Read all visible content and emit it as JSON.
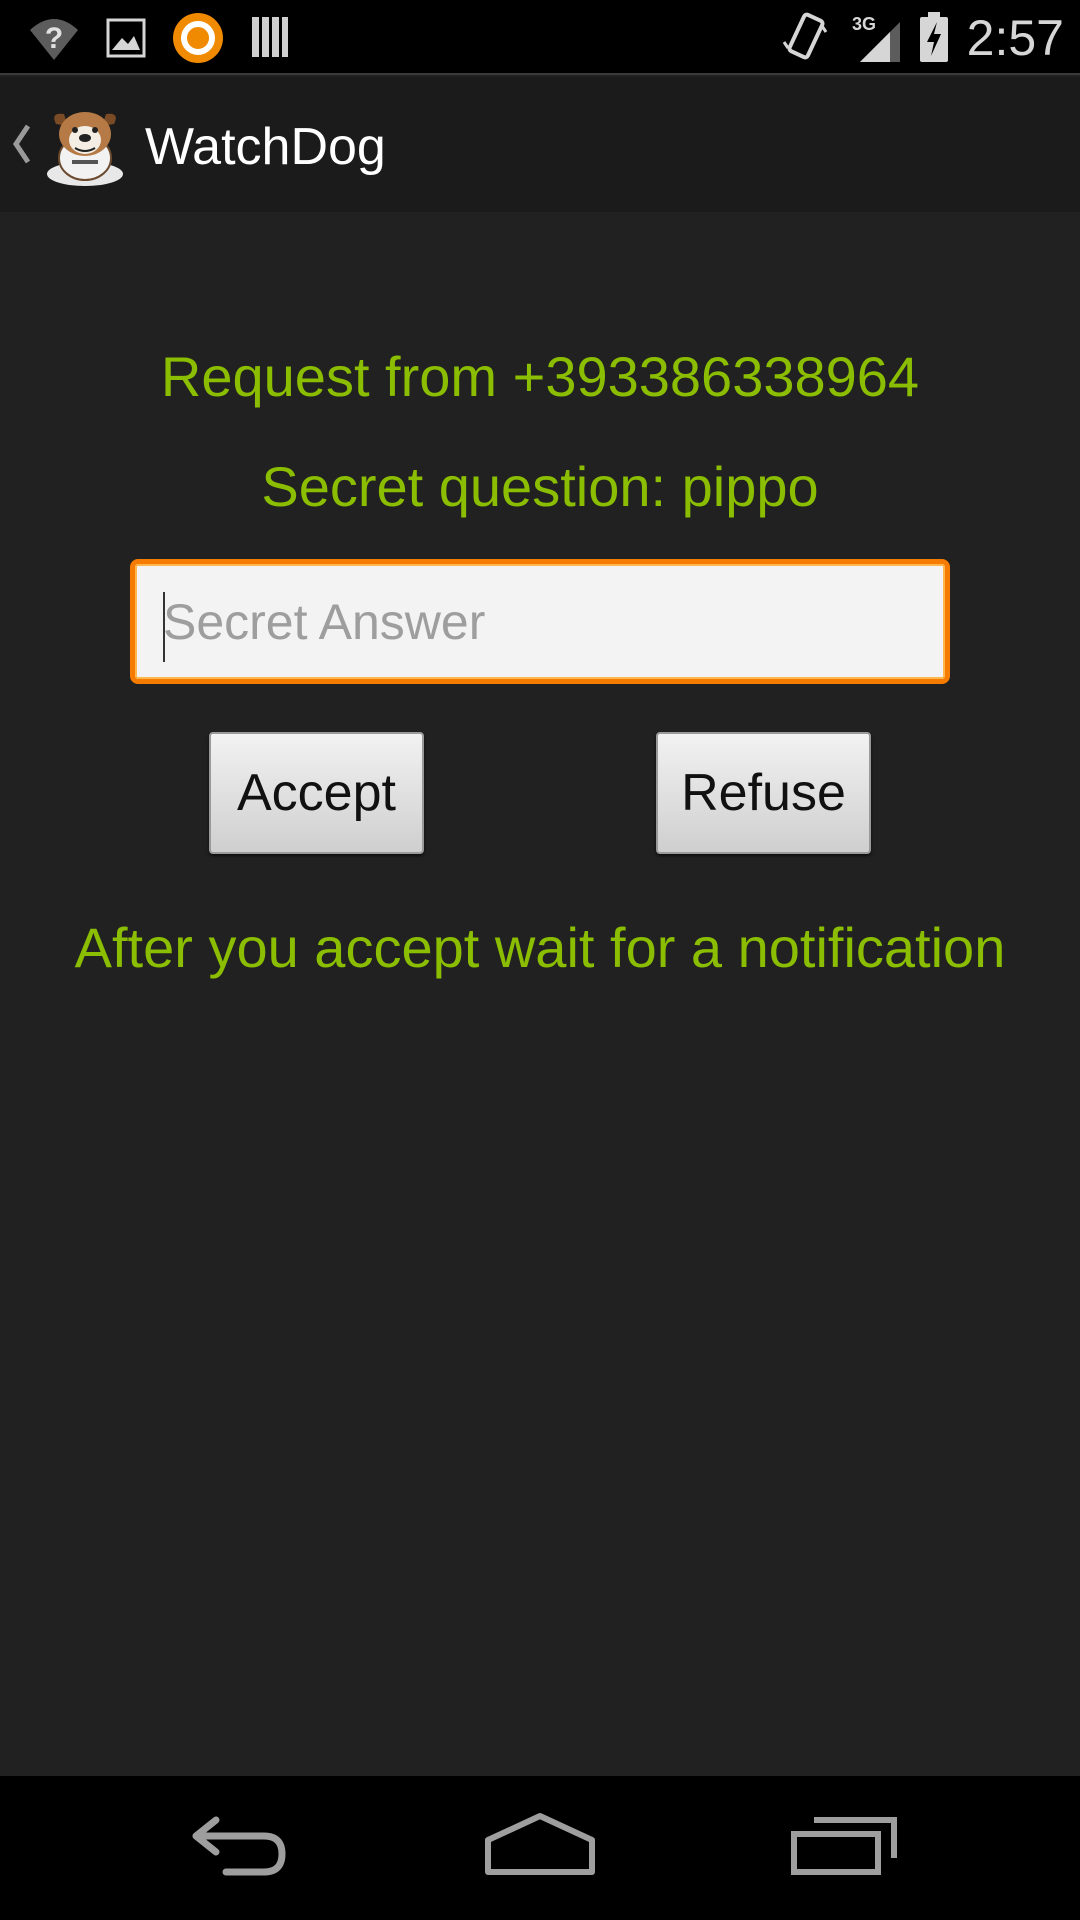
{
  "status_bar": {
    "time": "2:57",
    "network": "3G",
    "icons": [
      "wifi-question-icon",
      "gallery-icon",
      "avast-icon",
      "barcode-icon",
      "vibrate-icon",
      "signal-icon",
      "battery-charging-icon"
    ]
  },
  "action_bar": {
    "title": "WatchDog",
    "logo": "bulldog-logo"
  },
  "main": {
    "request_text": "Request from +393386338964",
    "secret_question_text": "Secret question: pippo",
    "answer_placeholder": "Secret Answer",
    "answer_value": "",
    "accept_label": "Accept",
    "refuse_label": "Refuse",
    "note_text": "After you accept wait for a notification"
  },
  "nav_bar": {
    "buttons": [
      "back-icon",
      "home-icon",
      "recents-icon"
    ]
  },
  "colors": {
    "accent_green": "#8bbd00",
    "focus_orange": "#f57c00",
    "background": "#212121"
  }
}
